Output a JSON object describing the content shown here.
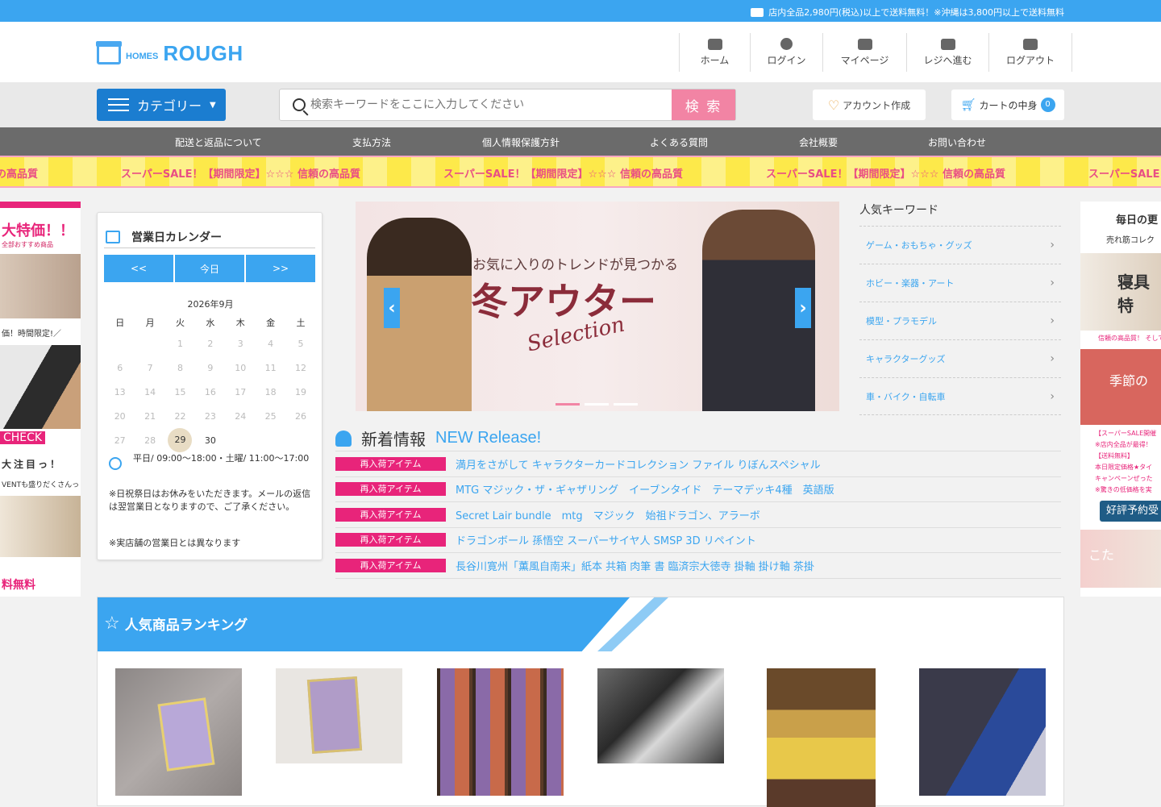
{
  "topbar": {
    "message": "店内全品2,980円(税込)以上で送料無料！※沖縄は3,800円以上で送料無料",
    "icon": "truck-icon"
  },
  "logo": {
    "small": "HOMES",
    "big": "ROUGH",
    "icon": "store-icon"
  },
  "header_nav": [
    {
      "label": "ホーム",
      "icon": "home-icon"
    },
    {
      "label": "ログイン",
      "icon": "user-icon"
    },
    {
      "label": "マイページ",
      "icon": "id-card-icon"
    },
    {
      "label": "レジへ進む",
      "icon": "register-icon"
    },
    {
      "label": "ログアウト",
      "icon": "logout-icon"
    }
  ],
  "category_button": "カテゴリー",
  "search": {
    "placeholder": "検索キーワードをここに入力してください",
    "button": "検 索"
  },
  "account_button": "アカウント作成",
  "cart": {
    "label": "カートの中身",
    "count": "0"
  },
  "global_nav": [
    "配送と返品について",
    "支払方法",
    "個人情報保護方針",
    "よくある質問",
    "会社概要",
    "お問い合わせ"
  ],
  "banner_text": "スーパーSALE！【期間限定】☆☆☆ 信頼の高品質",
  "left_ad": {
    "big": "大特価！！",
    "small": "全部おすすめ商品",
    "line1": "価！時間限定!／",
    "check": "CHECK",
    "line2": "大注目っ！",
    "line3": "VENTも盛りだくさんっ",
    "free": "料無料"
  },
  "calendar": {
    "title": "営業日カレンダー",
    "prev": "<<",
    "today": "今日",
    "next": ">>",
    "month": "2026年9月",
    "weekdays": [
      "日",
      "月",
      "火",
      "水",
      "木",
      "金",
      "土"
    ],
    "weeks": [
      [
        "",
        "",
        "1",
        "2",
        "3",
        "4",
        "5"
      ],
      [
        "6",
        "7",
        "8",
        "9",
        "10",
        "11",
        "12"
      ],
      [
        "13",
        "14",
        "15",
        "16",
        "17",
        "18",
        "19"
      ],
      [
        "20",
        "21",
        "22",
        "23",
        "24",
        "25",
        "26"
      ],
      [
        "27",
        "28",
        "29",
        "30",
        "",
        "",
        ""
      ]
    ],
    "today_date": "29",
    "hours": "平日/ 09:00～18:00・土曜/ 11:00～17:00",
    "note": "※日祝祭日はお休みをいただきます。メールの返信は翌営業日となりますので、ご了承ください。",
    "note2": "※実店舗の営業日とは異なります"
  },
  "slider": {
    "line1": "お気に入りのトレンドが見つかる",
    "line2": "冬アウター",
    "line3": "Selection",
    "prev": "‹",
    "next": "›",
    "active_slide": 1,
    "slide_count": 3
  },
  "keywords": {
    "title": "人気キーワード",
    "items": [
      "ゲーム・おもちゃ・グッズ",
      "ホビー・楽器・アート",
      "模型・プラモデル",
      "キャラクターグッズ",
      "車・バイク・自転車"
    ]
  },
  "right_ad": {
    "t1": "毎日の更",
    "t2": "売れ筋コレク",
    "img_text": "寝具特",
    "pink": "信頼の高品質！ そして安",
    "img2_text": "季節の",
    "list": [
      "【スーパーSALE開催",
      "※店内全品が最得！",
      "【送料無料】",
      "本日限定価格★タイ",
      "キャンペーンぜった",
      "※驚きの低価格を実"
    ],
    "button": "好評予約受",
    "img3_text": "こた"
  },
  "news": {
    "title": "新着情報",
    "subtitle": "NEW Release!",
    "items": [
      {
        "badge": "再入荷アイテム",
        "text": "満月をさがして キャラクターカードコレクション ファイル りぼんスペシャル"
      },
      {
        "badge": "再入荷アイテム",
        "text": "MTG マジック・ザ・ギャザリング　イーブンタイド　テーマデッキ4種　英語版"
      },
      {
        "badge": "再入荷アイテム",
        "text": "Secret Lair bundle　mtg　マジック　始祖ドラゴン、アラーボ"
      },
      {
        "badge": "再入荷アイテム",
        "text": "ドラゴンボール 孫悟空 スーパーサイヤ人 SMSP 3D リペイント"
      },
      {
        "badge": "再入荷アイテム",
        "text": "長谷川寛州「薫風自南来」紙本 共箱 肉筆 書 臨済宗大徳寺 掛軸 掛け軸 茶掛"
      }
    ]
  },
  "ranking": {
    "title": "人気商品ランキング"
  },
  "colors": {
    "accent": "#3ba5f0",
    "pink": "#f284a4",
    "badge": "#e8247a",
    "nav": "#6b6b6b"
  }
}
